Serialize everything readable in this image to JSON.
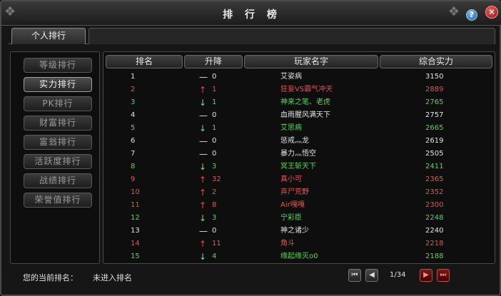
{
  "window": {
    "title": "排 行 榜",
    "help_label": "?",
    "close_label": "✕"
  },
  "tabs": [
    {
      "label": "个人排行"
    }
  ],
  "categories": [
    {
      "label": "等级排行",
      "active": false
    },
    {
      "label": "实力排行",
      "active": true
    },
    {
      "label": "PK排行",
      "active": false
    },
    {
      "label": "财富排行",
      "active": false
    },
    {
      "label": "富翁排行",
      "active": false
    },
    {
      "label": "活跃度排行",
      "active": false
    },
    {
      "label": "战绩排行",
      "active": false
    },
    {
      "label": "荣誉值排行",
      "active": false
    }
  ],
  "table": {
    "headers": {
      "rank": "排名",
      "change": "升降",
      "name": "玩家名字",
      "power": "综合实力"
    },
    "rows": [
      {
        "rank": "1",
        "dir": "flat",
        "change": "0",
        "name": "艾姿病",
        "power": "3150",
        "color": "white"
      },
      {
        "rank": "2",
        "dir": "up",
        "change": "1",
        "name": "狂妄VS霸气冲天",
        "power": "2889",
        "color": "red"
      },
      {
        "rank": "3",
        "dir": "down",
        "change": "1",
        "name": "神来之笔、老虎",
        "power": "2765",
        "color": "green"
      },
      {
        "rank": "4",
        "dir": "flat",
        "change": "0",
        "name": "血雨腥风满天下",
        "power": "2757",
        "color": "white"
      },
      {
        "rank": "5",
        "dir": "down",
        "change": "1",
        "name": "艾思病",
        "power": "2665",
        "color": "green"
      },
      {
        "rank": "6",
        "dir": "flat",
        "change": "0",
        "name": "惩戒灬龙",
        "power": "2619",
        "color": "white"
      },
      {
        "rank": "7",
        "dir": "flat",
        "change": "0",
        "name": "暴力灬悟空",
        "power": "2505",
        "color": "white"
      },
      {
        "rank": "8",
        "dir": "down",
        "change": "3",
        "name": "冥王斩天下",
        "power": "2411",
        "color": "green"
      },
      {
        "rank": "9",
        "dir": "up",
        "change": "32",
        "name": "真小可",
        "power": "2365",
        "color": "red"
      },
      {
        "rank": "10",
        "dir": "up",
        "change": "2",
        "name": "弃尸荒野",
        "power": "2352",
        "color": "red"
      },
      {
        "rank": "11",
        "dir": "up",
        "change": "8",
        "name": "Air嘎嘎",
        "power": "2300",
        "color": "red"
      },
      {
        "rank": "12",
        "dir": "down",
        "change": "3",
        "name": "宁彩臣",
        "power": "2248",
        "color": "green"
      },
      {
        "rank": "13",
        "dir": "flat",
        "change": "0",
        "name": "神之诸少",
        "power": "2240",
        "color": "white"
      },
      {
        "rank": "14",
        "dir": "up",
        "change": "11",
        "name": "角斗",
        "power": "2218",
        "color": "red"
      },
      {
        "rank": "15",
        "dir": "down",
        "change": "4",
        "name": "缘起缘灭o0",
        "power": "2188",
        "color": "green"
      }
    ]
  },
  "footer": {
    "rank_label": "您的当前排名：",
    "rank_value": "未进入排名",
    "page_indicator": "1/34"
  },
  "icons": {
    "up": "↑",
    "down": "↓",
    "flat": "—",
    "first": "⏮",
    "prev": "◀",
    "next": "▶",
    "last": "⏭"
  },
  "colors": {
    "white": "#e4e4e4",
    "red": "#e05555",
    "green": "#5cd25c"
  }
}
